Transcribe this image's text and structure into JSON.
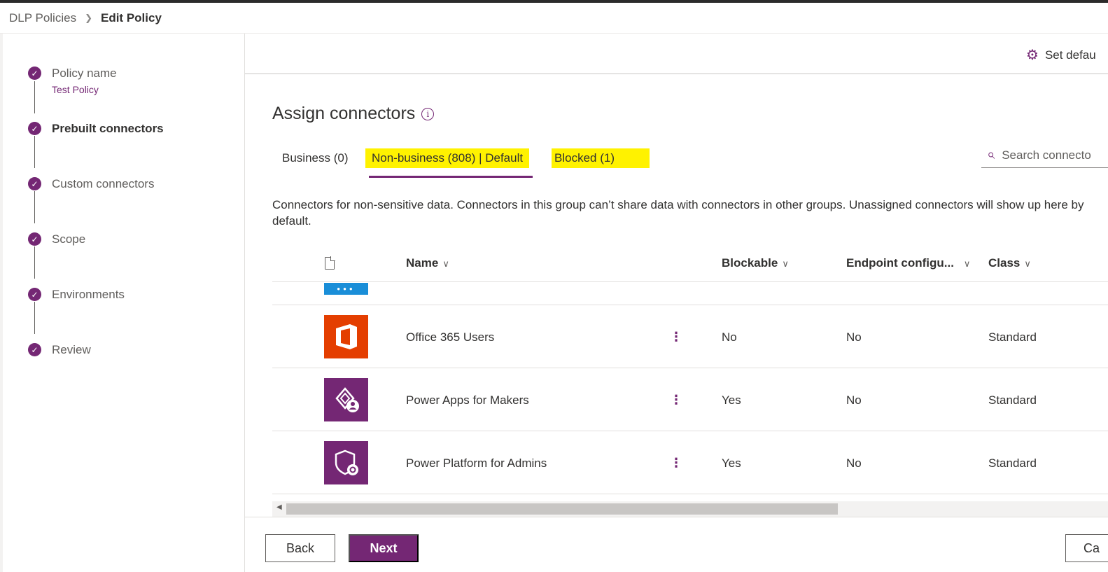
{
  "breadcrumb": {
    "parent": "DLP Policies",
    "current": "Edit Policy"
  },
  "steps": [
    {
      "label": "Policy name",
      "sub": "Test Policy",
      "active": false
    },
    {
      "label": "Prebuilt connectors",
      "sub": "",
      "active": true
    },
    {
      "label": "Custom connectors",
      "sub": "",
      "active": false
    },
    {
      "label": "Scope",
      "sub": "",
      "active": false
    },
    {
      "label": "Environments",
      "sub": "",
      "active": false
    },
    {
      "label": "Review",
      "sub": "",
      "active": false
    }
  ],
  "commandbar": {
    "set_default_label": "Set defau"
  },
  "page": {
    "title": "Assign connectors",
    "description": "Connectors for non-sensitive data. Connectors in this group can’t share data with connectors in other groups. Unassigned connectors will show up here by default."
  },
  "tabs": [
    {
      "label": "Business (0)",
      "selected": false,
      "highlighted": false
    },
    {
      "label": "Non-business (808) | Default",
      "selected": true,
      "highlighted": true
    },
    {
      "label": "Blocked (1)",
      "selected": false,
      "highlighted": true
    }
  ],
  "search": {
    "placeholder": "Search connecto"
  },
  "grid": {
    "columns": {
      "name": "Name",
      "blockable": "Blockable",
      "endpoint": "Endpoint configu...",
      "class": "Class"
    },
    "rows": [
      {
        "name": "Office 365 Users",
        "blockable": "No",
        "endpoint": "No",
        "class": "Standard",
        "icon": "office-365-icon",
        "color": "#e43e00"
      },
      {
        "name": "Power Apps for Makers",
        "blockable": "Yes",
        "endpoint": "No",
        "class": "Standard",
        "icon": "power-apps-makers-icon",
        "color": "#742774"
      },
      {
        "name": "Power Platform for Admins",
        "blockable": "Yes",
        "endpoint": "No",
        "class": "Standard",
        "icon": "power-platform-admins-icon",
        "color": "#742774"
      }
    ],
    "more_glyph": "⋮"
  },
  "footer": {
    "back_label": "Back",
    "next_label": "Next",
    "cancel_label": "Ca"
  },
  "colors": {
    "accent": "#742774",
    "highlight": "#fff200",
    "office": "#e43e00",
    "partial_row_icon": "#1a8ed8"
  }
}
